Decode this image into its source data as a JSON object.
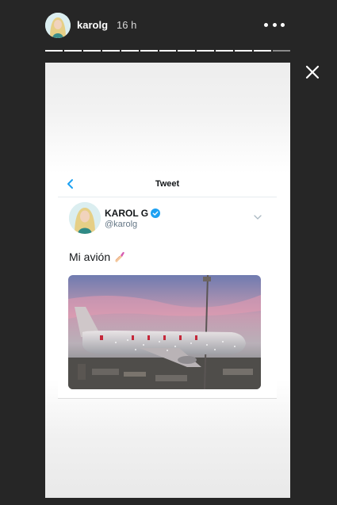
{
  "story": {
    "username": "karolg",
    "time": "16 h",
    "segments": 13
  },
  "tweet": {
    "header_title": "Tweet",
    "name": "KAROL G",
    "handle": "@karolg",
    "text": "Mi avión",
    "icons": {
      "back": "chevron-left-icon",
      "verified": "verified-badge-icon",
      "more": "chevron-down-icon",
      "emoji": "nail-polish-emoji"
    }
  },
  "colors": {
    "twitter_blue": "#1da1f2",
    "background": "#262626"
  }
}
